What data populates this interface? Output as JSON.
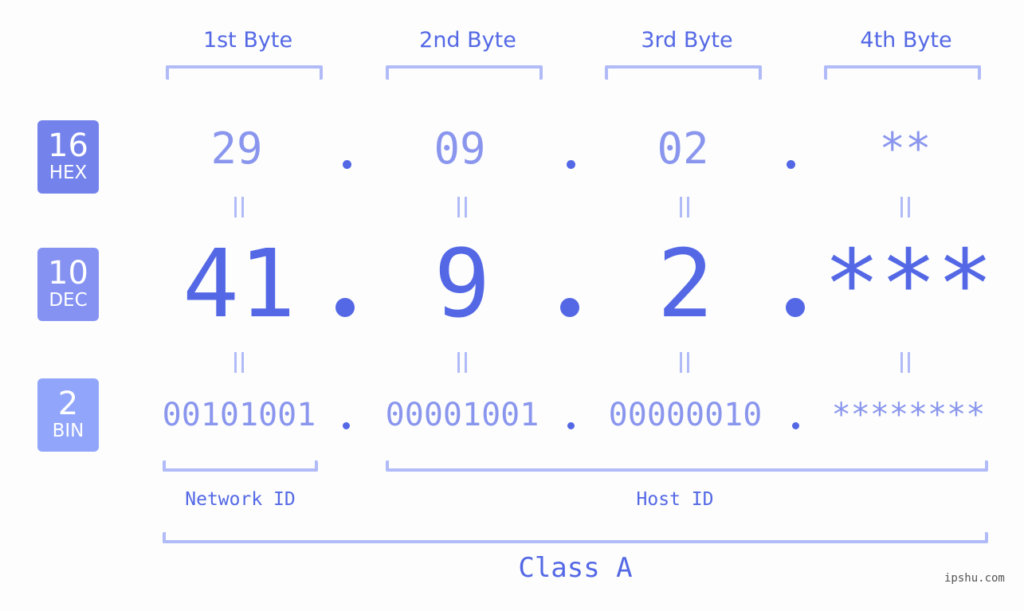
{
  "bytes": [
    {
      "header": "1st Byte",
      "hex": "29",
      "dec": "41",
      "bin": "00101001"
    },
    {
      "header": "2nd Byte",
      "hex": "09",
      "dec": "9",
      "bin": "00001001"
    },
    {
      "header": "3rd Byte",
      "hex": "02",
      "dec": "2",
      "bin": "00000010"
    },
    {
      "header": "4th Byte",
      "hex": "**",
      "dec": "***",
      "bin": "********"
    }
  ],
  "bases": [
    {
      "num": "16",
      "label": "HEX",
      "color": "#7482ec"
    },
    {
      "num": "10",
      "label": "DEC",
      "color": "#8592f2"
    },
    {
      "num": "2",
      "label": "BIN",
      "color": "#91a6fa"
    }
  ],
  "segments": {
    "network_id": "Network ID",
    "host_id": "Host ID",
    "class": "Class A"
  },
  "separator": ".",
  "watermark": "ipshu.com",
  "colors": {
    "accent": "#5468e6",
    "light_accent": "#8a96ee",
    "bracket": "#b1bbf8",
    "background": "#fcfdfc"
  }
}
